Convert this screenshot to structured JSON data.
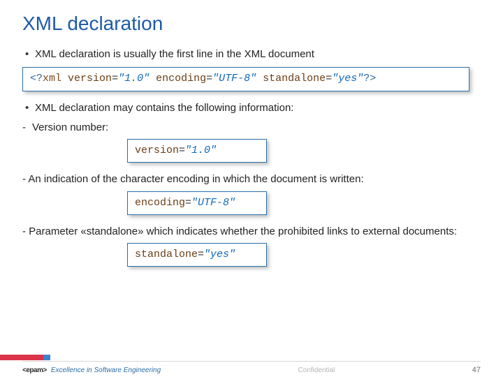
{
  "title": "XML declaration",
  "bullets": {
    "b1": "XML declaration is usually the first line in the XML document",
    "b2": "XML declaration may contains the following information:"
  },
  "dashes": {
    "d1": "Version number:",
    "d2": "An indication of the character encoding in which the document is written:",
    "d3": "Parameter «standalone» which indicates whether the prohibited links to external documents:"
  },
  "code": {
    "full": {
      "open": "<?",
      "tag": "xml",
      "sp": " ",
      "a1": "version",
      "eq": "=",
      "v1": "\"1.0\"",
      "a2": "encoding",
      "v2": "\"UTF-8\"",
      "a3": "standalone",
      "v3": "\"yes\"",
      "close": "?>"
    },
    "s1": {
      "attr": "version",
      "eq": "=",
      "val": "\"1.0\""
    },
    "s2": {
      "attr": "encoding",
      "eq": "=",
      "val": "\"UTF-8\""
    },
    "s3": {
      "attr": "standalone",
      "eq": "=",
      "val": "\"yes\""
    }
  },
  "footer": {
    "brand_logo": "epam",
    "brand_open": "<",
    "brand_close": ">",
    "brand_tag": "Excellence in Software Engineering",
    "confidential": "Confidential",
    "page": "47"
  }
}
